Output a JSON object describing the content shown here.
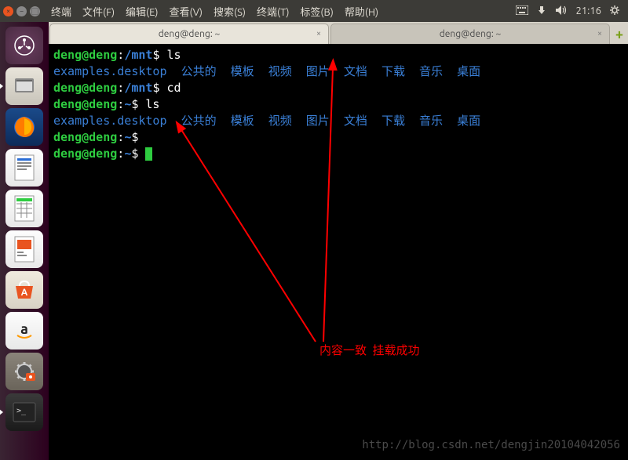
{
  "menubar": {
    "items": [
      "终端",
      "文件(F)",
      "编辑(E)",
      "查看(V)",
      "搜索(S)",
      "终端(T)",
      "标签(B)",
      "帮助(H)"
    ],
    "clock": "21:16"
  },
  "tabs": {
    "tab1": "deng@deng: ~",
    "tab2": "deng@deng: ~"
  },
  "terminal": {
    "lines": [
      {
        "prompt": {
          "user": "deng@deng",
          "sep": ":",
          "path": "/mnt",
          "dollar": "$"
        },
        "cmd": "ls"
      },
      {
        "listing": {
          "file": "examples.desktop",
          "dirs": [
            "公共的",
            "模板",
            "视频",
            "图片",
            "文档",
            "下载",
            "音乐",
            "桌面"
          ]
        }
      },
      {
        "prompt": {
          "user": "deng@deng",
          "sep": ":",
          "path": "/mnt",
          "dollar": "$"
        },
        "cmd": "cd"
      },
      {
        "prompt": {
          "user": "deng@deng",
          "sep": ":",
          "path": "~",
          "dollar": "$"
        },
        "cmd": "ls"
      },
      {
        "listing": {
          "file": "examples.desktop",
          "dirs": [
            "公共的",
            "模板",
            "视频",
            "图片",
            "文档",
            "下载",
            "音乐",
            "桌面"
          ]
        }
      },
      {
        "prompt": {
          "user": "deng@deng",
          "sep": ":",
          "path": "~",
          "dollar": "$"
        },
        "cmd": ""
      },
      {
        "prompt": {
          "user": "deng@deng",
          "sep": ":",
          "path": "~",
          "dollar": "$"
        },
        "cmd": "",
        "cursor": true
      }
    ]
  },
  "annotation": {
    "text1": "内容一致",
    "text2": "挂载成功"
  },
  "watermark": "http://blog.csdn.net/dengjin20104042056"
}
